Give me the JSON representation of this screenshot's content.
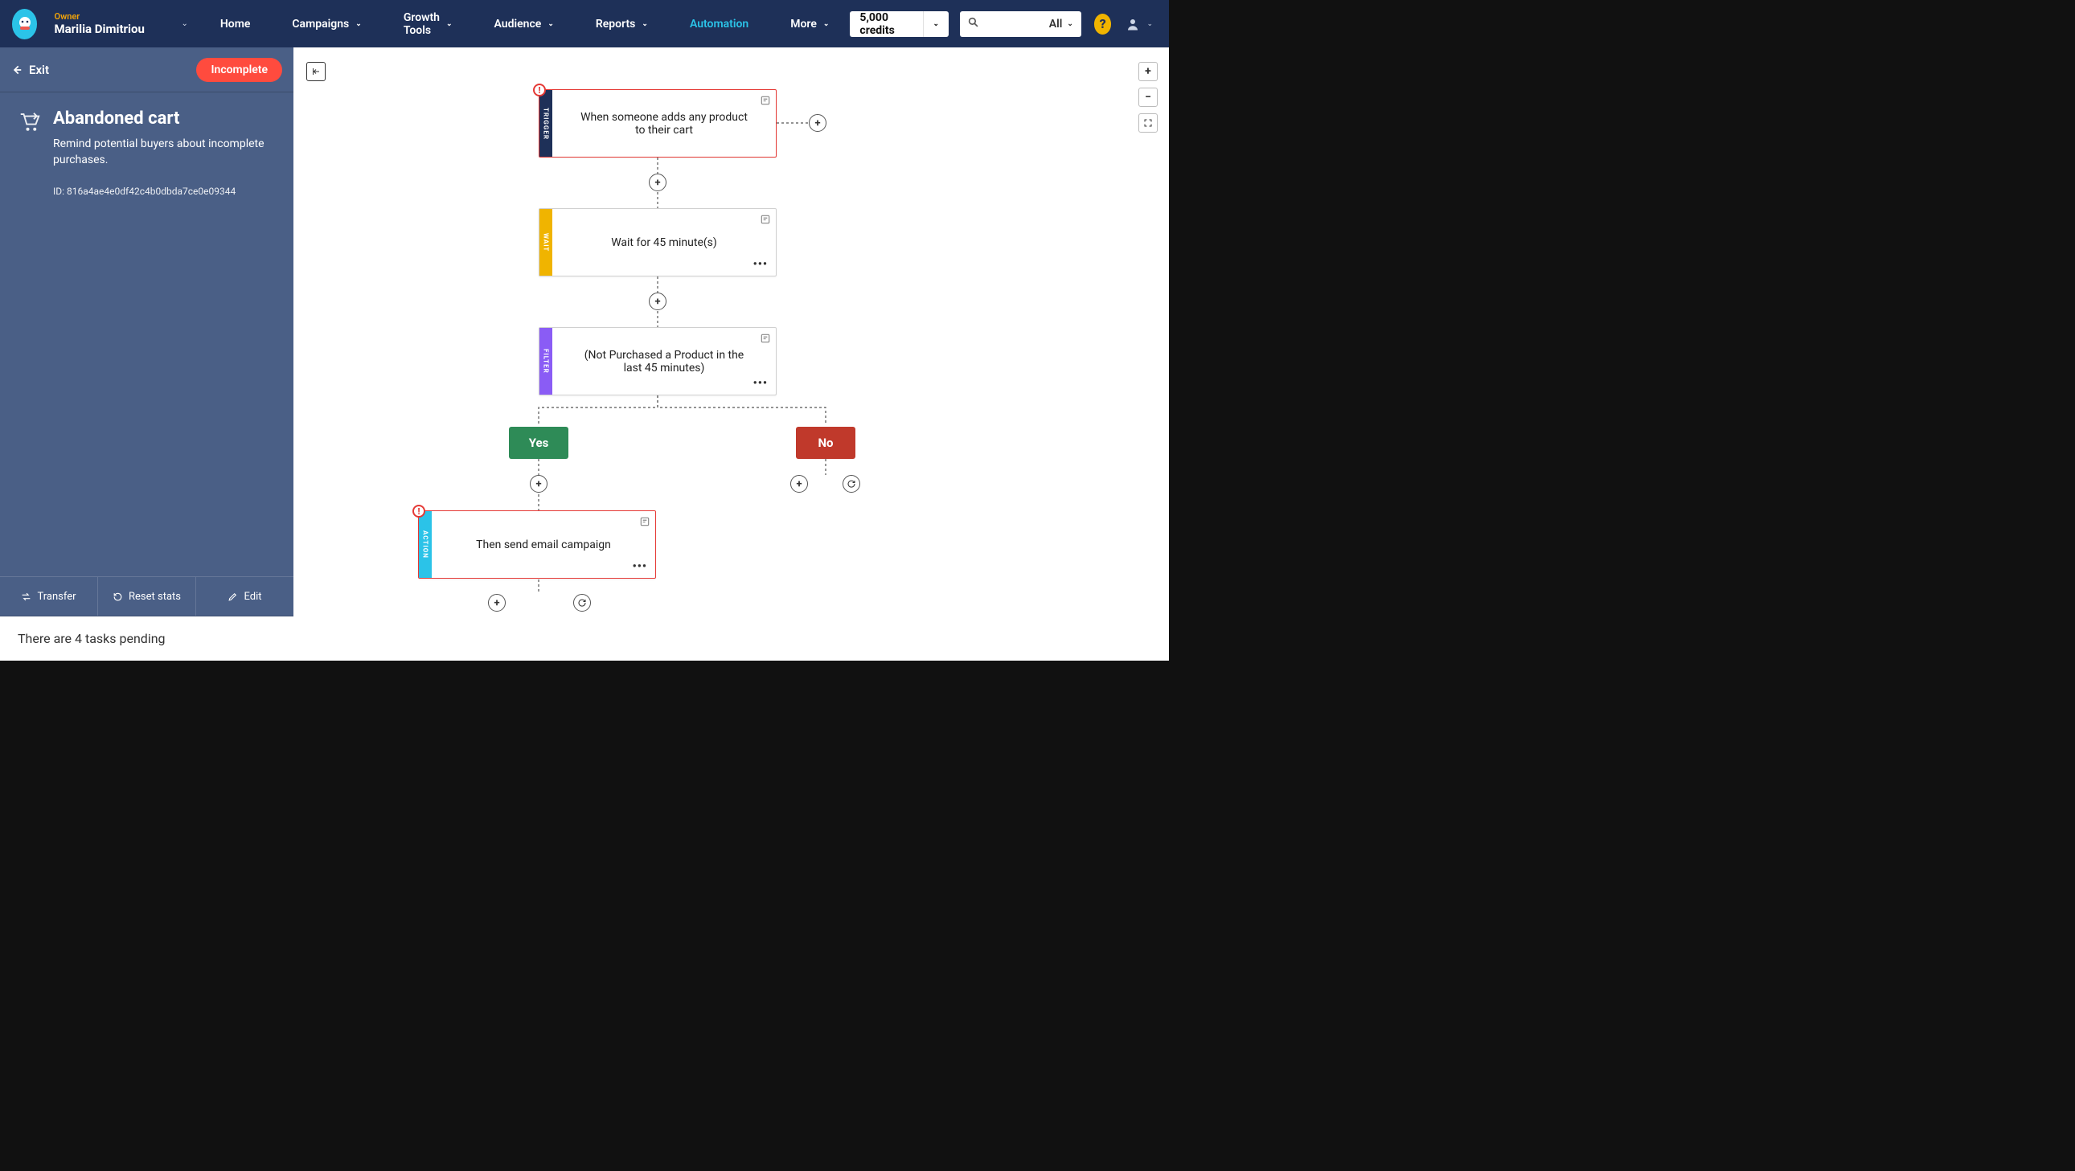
{
  "header": {
    "owner_label": "Owner",
    "owner_name": "Marilia Dimitriou",
    "nav": {
      "home": "Home",
      "campaigns": "Campaigns",
      "growth": "Growth Tools",
      "audience": "Audience",
      "reports": "Reports",
      "automation": "Automation",
      "more": "More"
    },
    "credits": "5,000 credits",
    "search_filter": "All"
  },
  "sidebar": {
    "exit": "Exit",
    "status": "Incomplete",
    "title": "Abandoned cart",
    "description": "Remind potential buyers about incomplete purchases.",
    "id_line": "ID: 816a4ae4e0df42c4b0dbda7ce0e09344",
    "actions": {
      "transfer": "Transfer",
      "reset": "Reset stats",
      "edit": "Edit"
    },
    "pending": "There are 4 tasks pending"
  },
  "nodes": {
    "trigger": {
      "label": "TRIGGER",
      "text": "When someone adds any product to their cart"
    },
    "wait": {
      "label": "WAIT",
      "text": "Wait for 45 minute(s)"
    },
    "filter": {
      "label": "FILTER",
      "text": "(Not Purchased a Product in the last 45 minutes)"
    },
    "yes": "Yes",
    "no": "No",
    "action": {
      "label": "ACTION",
      "text": "Then send email campaign"
    }
  }
}
